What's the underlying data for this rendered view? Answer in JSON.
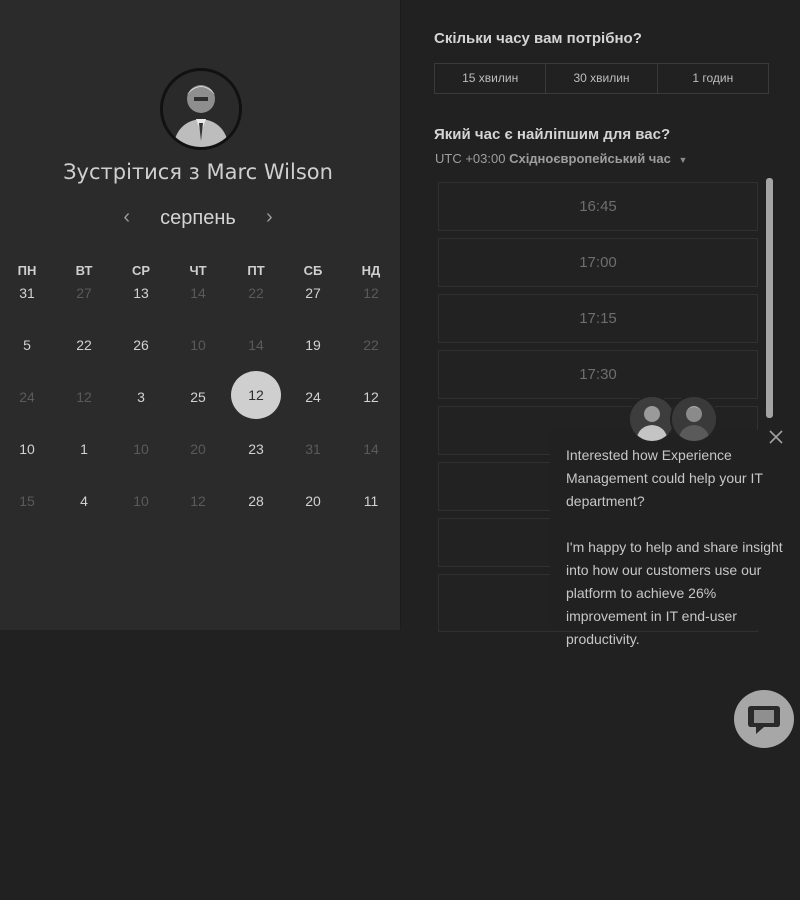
{
  "meet": {
    "title": "Зустрітися з Marc Wilson"
  },
  "calendar": {
    "month": "серпень",
    "prev": "‹",
    "next": "›",
    "weekdays": [
      "ПН",
      "ВТ",
      "СР",
      "ЧТ",
      "ПТ",
      "СБ",
      "НД"
    ],
    "weeks": [
      [
        {
          "d": "31",
          "on": true
        },
        {
          "d": "27",
          "on": false
        },
        {
          "d": "13",
          "on": true
        },
        {
          "d": "14",
          "on": false
        },
        {
          "d": "22",
          "on": false
        },
        {
          "d": "27",
          "on": true
        },
        {
          "d": "12",
          "on": false
        }
      ],
      [
        {
          "d": "5",
          "on": true
        },
        {
          "d": "22",
          "on": true
        },
        {
          "d": "26",
          "on": true
        },
        {
          "d": "10",
          "on": false
        },
        {
          "d": "14",
          "on": false
        },
        {
          "d": "19",
          "on": true
        },
        {
          "d": "22",
          "on": false
        }
      ],
      [
        {
          "d": "24",
          "on": false
        },
        {
          "d": "12",
          "on": false
        },
        {
          "d": "3",
          "on": true
        },
        {
          "d": "25",
          "on": true
        },
        {
          "d": "12",
          "on": true,
          "selected": true
        },
        {
          "d": "24",
          "on": true
        },
        {
          "d": "12",
          "on": true
        }
      ],
      [
        {
          "d": "10",
          "on": true
        },
        {
          "d": "1",
          "on": true
        },
        {
          "d": "10",
          "on": false
        },
        {
          "d": "20",
          "on": false
        },
        {
          "d": "23",
          "on": true
        },
        {
          "d": "31",
          "on": false
        },
        {
          "d": "14",
          "on": false
        }
      ],
      [
        {
          "d": "15",
          "on": false
        },
        {
          "d": "4",
          "on": true
        },
        {
          "d": "10",
          "on": false
        },
        {
          "d": "12",
          "on": false
        },
        {
          "d": "28",
          "on": true
        },
        {
          "d": "20",
          "on": true
        },
        {
          "d": "11",
          "on": true
        }
      ]
    ]
  },
  "duration": {
    "question": "Скільки часу вам потрібно?",
    "options": [
      "15 хвилин",
      "30 хвилин",
      "1 годин"
    ]
  },
  "times": {
    "question": "Який час є найліпшим для вас?",
    "tz_prefix": "UTC +03:00",
    "tz_name": "Східноєвропейський час",
    "slots": [
      "16:45",
      "17:00",
      "17:15",
      "17:30",
      "",
      "",
      "",
      ""
    ]
  },
  "chat": {
    "message_1": "Interested how Experience Management could help your IT department?",
    "message_2": "I'm happy to help and share insight into how our customers use our platform to achieve 26% improvement in IT end-user productivity."
  },
  "icons": {
    "prev": "chevron-left-icon",
    "next": "chevron-right-icon",
    "tz_caret": "caret-down-icon",
    "close": "close-icon",
    "chat": "chat-bubble-icon"
  }
}
